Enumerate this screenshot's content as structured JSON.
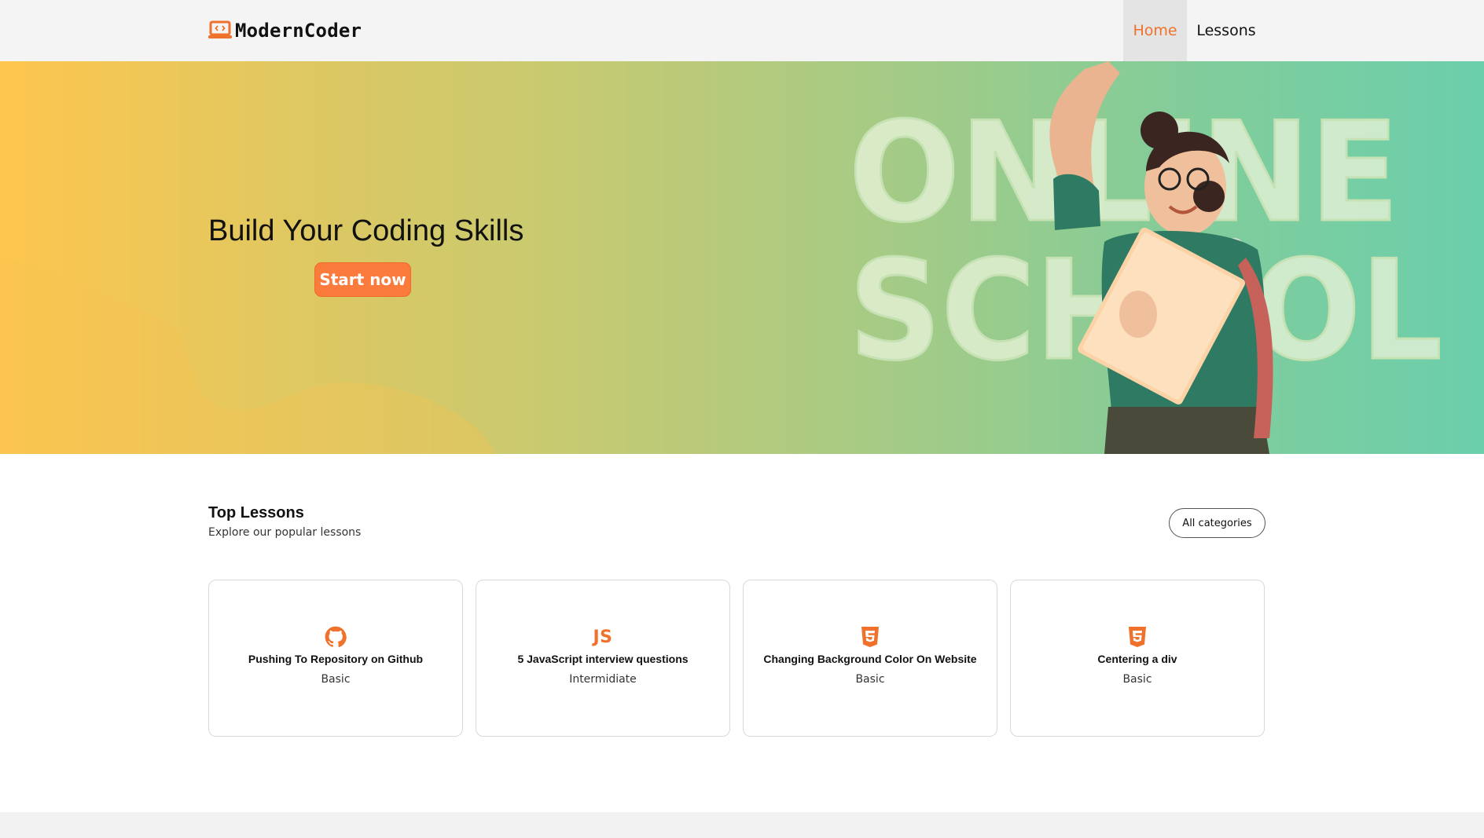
{
  "brand": {
    "name": "ModernCoder",
    "logo_icon": "laptop-code-icon",
    "accent": "#f0712c"
  },
  "nav": {
    "items": [
      {
        "label": "Home",
        "active": true
      },
      {
        "label": "Lessons",
        "active": false
      }
    ]
  },
  "hero": {
    "title": "Build Your Coding Skills",
    "cta_label": "Start now",
    "art_text": [
      "ONLINE",
      "SCHOOL"
    ],
    "gradient": [
      "#fec64e",
      "#6bcfac"
    ]
  },
  "lessons": {
    "title": "Top Lessons",
    "subtitle": "Explore our popular lessons",
    "all_categories_label": "All categories",
    "cards": [
      {
        "icon": "github-icon",
        "title": "Pushing To Repository on Github",
        "level": "Basic"
      },
      {
        "icon": "javascript-icon",
        "icon_text": "JS",
        "title": "5 JavaScript interview questions",
        "level": "Intermidiate"
      },
      {
        "icon": "css3-icon",
        "title": "Changing Background Color On Website",
        "level": "Basic"
      },
      {
        "icon": "css3-icon",
        "title": "Centering a div",
        "level": "Basic"
      }
    ]
  }
}
